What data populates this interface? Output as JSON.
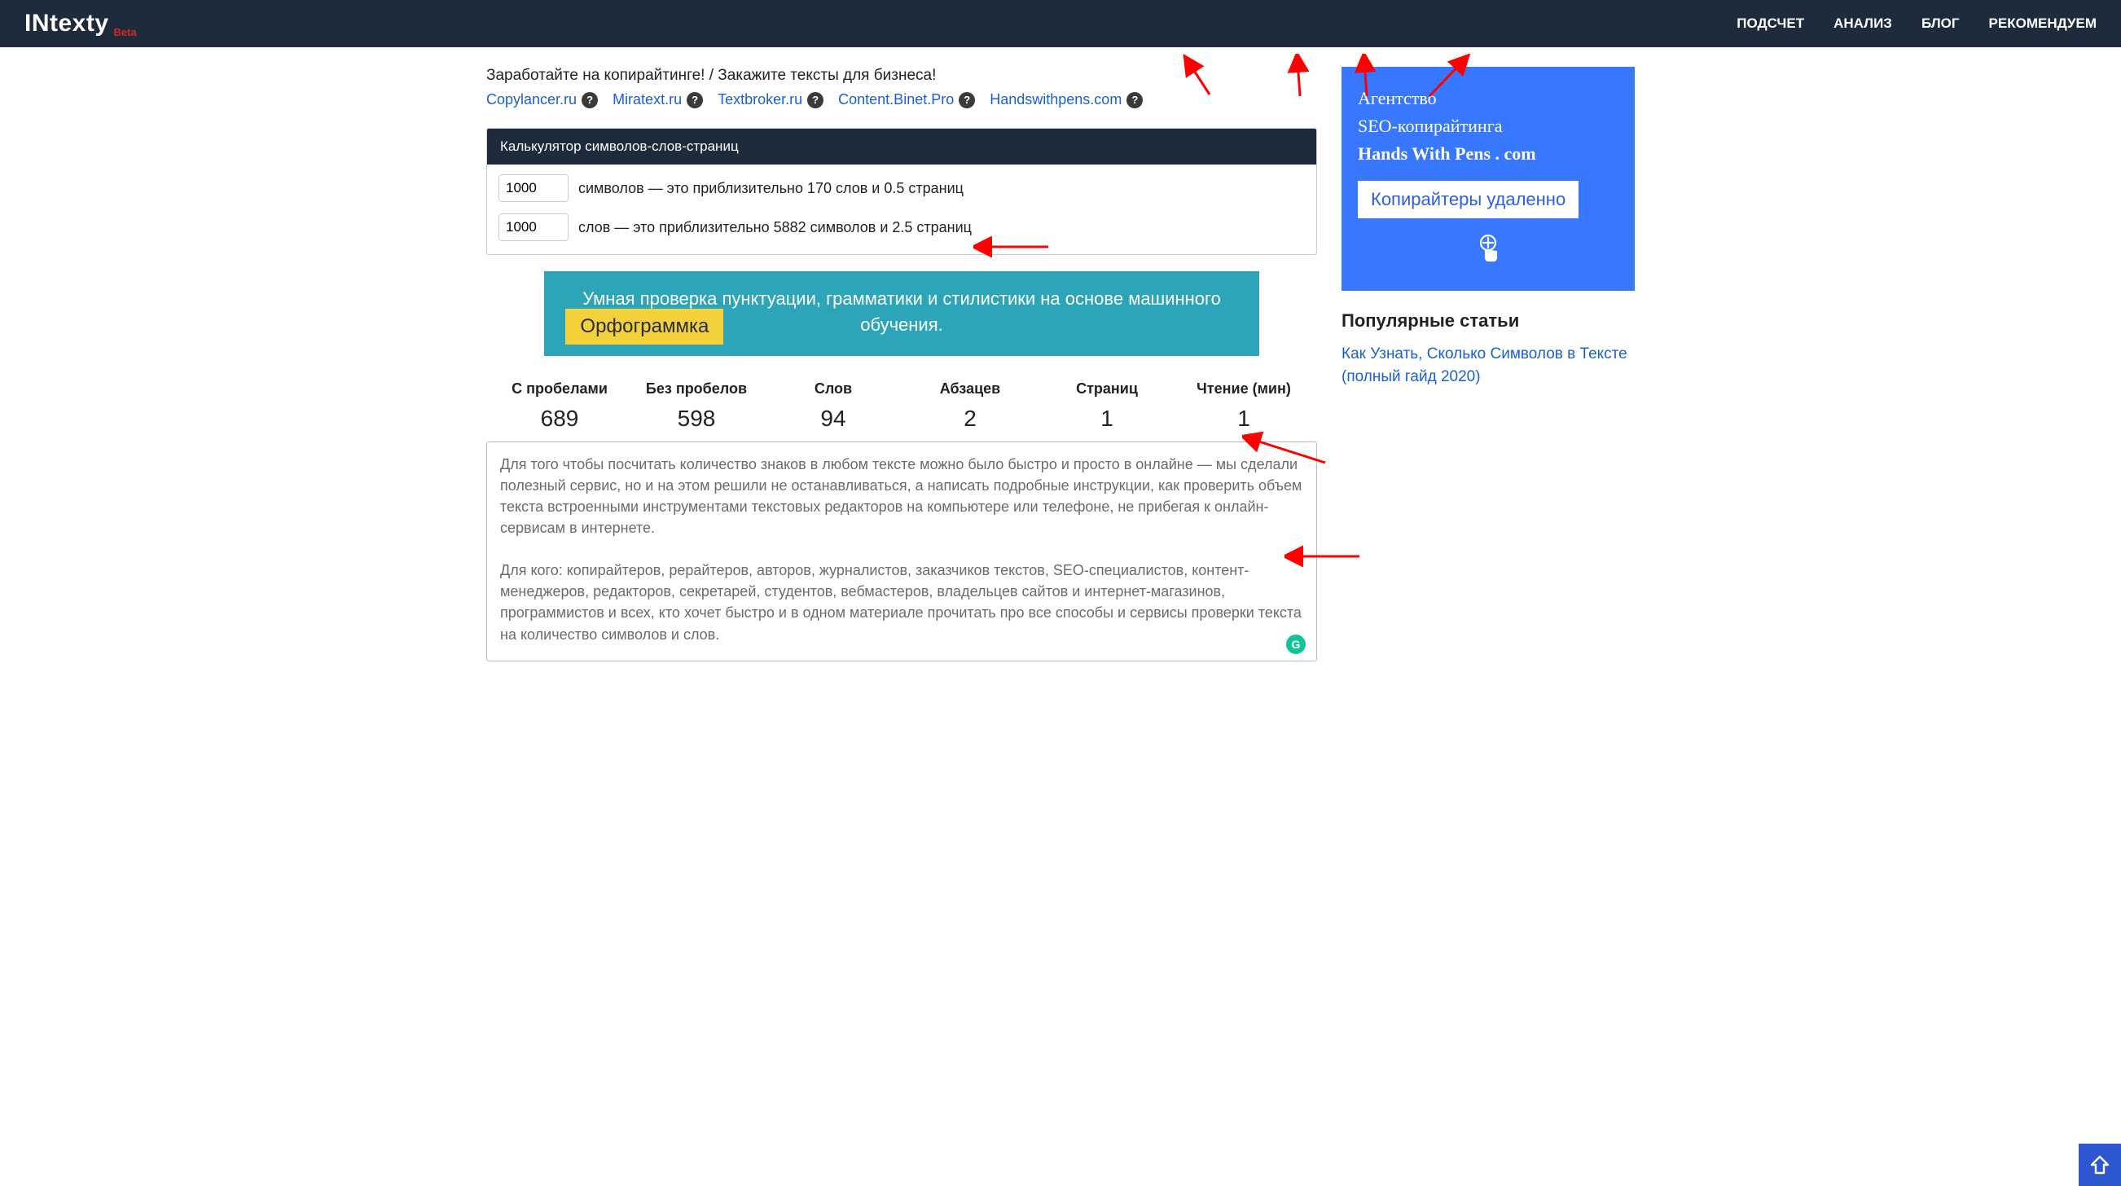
{
  "header": {
    "logo_prefix": "IN",
    "logo_suffix": "texty",
    "beta": "Beta",
    "nav": [
      "ПОДСЧЕТ",
      "АНАЛИЗ",
      "БЛОГ",
      "РЕКОМЕНДУЕМ"
    ]
  },
  "promo": {
    "headline": "Заработайте на копирайтинге! / Закажите тексты для бизнеса!",
    "links": [
      "Copylancer.ru",
      "Miratext.ru",
      "Textbroker.ru",
      "Content.Binet.Pro",
      "Handswithpens.com"
    ]
  },
  "calculator": {
    "title": "Калькулятор символов-слов-страниц",
    "input1": "1000",
    "text1": "символов — это приблизительно 170 слов и 0.5 страниц",
    "input2": "1000",
    "text2": "слов — это приблизительно 5882 символов и 2.5 страниц"
  },
  "banner1": {
    "text": "Умная проверка пунктуации, грамматики и стилистики на основе машинного обучения.",
    "badge": "Орфограммка"
  },
  "stats": {
    "labels": [
      "С пробелами",
      "Без пробелов",
      "Слов",
      "Абзацев",
      "Страниц",
      "Чтение (мин)"
    ],
    "values": [
      "689",
      "598",
      "94",
      "2",
      "1",
      "1"
    ]
  },
  "textarea_value": "Для того чтобы посчитать количество знаков в любом тексте можно было быстро и просто в онлайне — мы сделали полезный сервис, но и на этом решили не останавливаться, а написать подробные инструкции, как проверить объем текста встроенными инструментами текстовых редакторов на компьютере или телефоне, не прибегая к онлайн-сервисам в интернете.\n\nДля кого: копирайтеров, рерайтеров, авторов, журналистов, заказчиков текстов, SEO-специалистов, контент-менеджеров, редакторов, секретарей, студентов, вебмастеров, владельцев сайтов и интернет-магазинов, программистов и всех, кто хочет быстро и в одном материале прочитать про все способы и сервисы проверки текста на количество символов и слов.",
  "sidebar": {
    "banner": {
      "line1": "Агентство",
      "line2": "SEO-копирайтинга",
      "line3": "Hands With Pens . com",
      "button": "Копирайтеры удаленно"
    },
    "popular_title": "Популярные статьи",
    "popular_link": "Как Узнать, Сколько Символов в Тексте (полный гайд 2020)"
  },
  "grammarly": "G"
}
